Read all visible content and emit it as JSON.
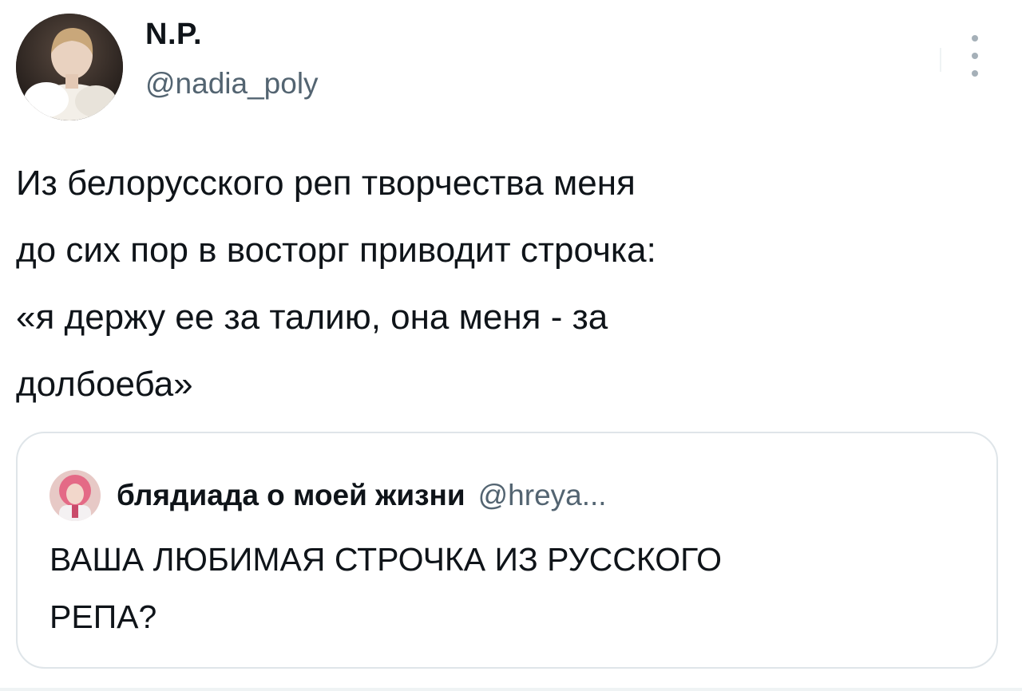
{
  "author": {
    "display_name": "N.P.",
    "handle": "@nadia_poly"
  },
  "tweet": {
    "text_lines": [
      "Из белорусского реп творчества меня",
      "до сих пор в восторг приводит строчка:",
      "«я держу ее за талию, она меня - за",
      "долбоеба»"
    ]
  },
  "quoted_tweet": {
    "display_name": "блядиада о моей жизни",
    "handle": "@hreya...",
    "text_lines": [
      "ВАША ЛЮБИМАЯ СТРОЧКА ИЗ РУССКОГО",
      "РЕПА?"
    ]
  },
  "icons": {
    "more": "more-vertical-icon"
  },
  "colors": {
    "text_primary": "#0f1419",
    "text_secondary": "#536471",
    "border": "#dfe5e9",
    "background": "#ffffff"
  }
}
